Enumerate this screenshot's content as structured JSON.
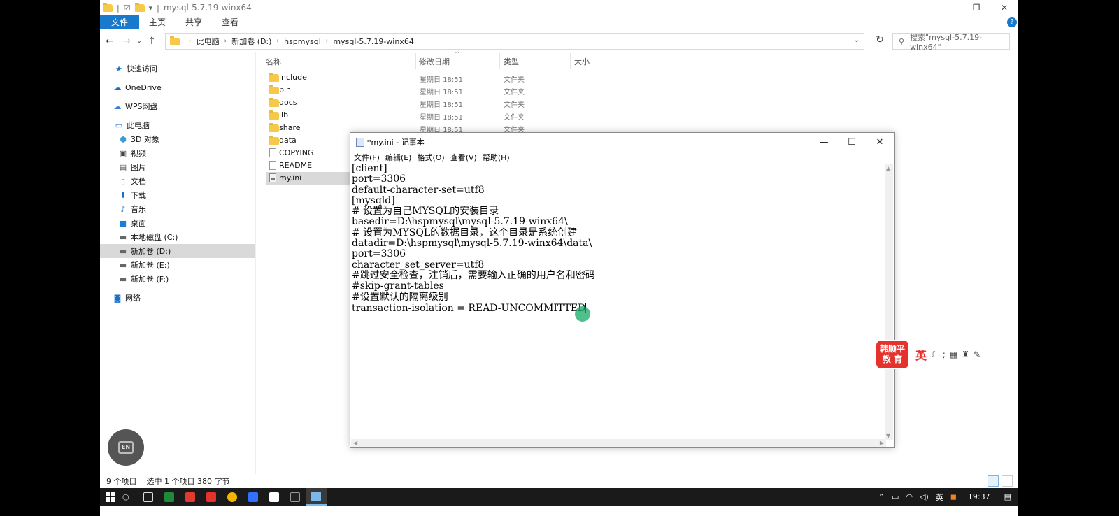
{
  "explorer": {
    "title": "mysql-5.7.19-winx64",
    "ribbon_tabs": [
      "文件",
      "主页",
      "共享",
      "查看"
    ],
    "breadcrumb": [
      "此电脑",
      "新加卷 (D:)",
      "hspmysql",
      "mysql-5.7.19-winx64"
    ],
    "search_placeholder": "搜索\"mysql-5.7.19-winx64\"",
    "nav": {
      "quick_access": "快速访问",
      "onedrive": "OneDrive",
      "wps": "WPS网盘",
      "this_pc": "此电脑",
      "objects3d": "3D 对象",
      "videos": "视频",
      "pictures": "图片",
      "documents": "文档",
      "downloads": "下载",
      "music": "音乐",
      "desktop": "桌面",
      "drive_c": "本地磁盘 (C:)",
      "drive_d": "新加卷 (D:)",
      "drive_e": "新加卷 (E:)",
      "drive_f": "新加卷 (F:)",
      "network": "网络"
    },
    "columns": {
      "name": "名称",
      "date": "修改日期",
      "type": "类型",
      "size": "大小"
    },
    "files": [
      {
        "name": "include",
        "date": "星期日 18:51",
        "type": "文件夹"
      },
      {
        "name": "bin",
        "date": "星期日 18:51",
        "type": "文件夹"
      },
      {
        "name": "docs",
        "date": "星期日 18:51",
        "type": "文件夹"
      },
      {
        "name": "lib",
        "date": "星期日 18:51",
        "type": "文件夹"
      },
      {
        "name": "share",
        "date": "星期日 18:51",
        "type": "文件夹"
      },
      {
        "name": "data",
        "date": "",
        "type": ""
      },
      {
        "name": "COPYING",
        "date": "",
        "type": ""
      },
      {
        "name": "README",
        "date": "",
        "type": ""
      },
      {
        "name": "my.ini",
        "date": "",
        "type": ""
      }
    ],
    "status": {
      "count": "9 个项目",
      "selection": "选中 1 个项目 380 字节"
    }
  },
  "notepad": {
    "title": "*my.ini - 记事本",
    "menu": [
      "文件(F)",
      "编辑(E)",
      "格式(O)",
      "查看(V)",
      "帮助(H)"
    ],
    "lines": [
      "[client]",
      "port=3306",
      "default-character-set=utf8",
      "[mysqld]",
      "# 设置为自己MYSQL的安装目录",
      "basedir=D:\\hspmysql\\mysql-5.7.19-winx64\\",
      "# 设置为MYSQL的数据目录，这个目录是系统创建",
      "datadir=D:\\hspmysql\\mysql-5.7.19-winx64\\data\\",
      "port=3306",
      "character_set_server=utf8",
      "#跳过安全检查，注销后，需要输入正确的用户名和密码",
      "#skip-grant-tables",
      "#设置默认的隔离级别",
      "transaction-isolation = READ-UNCOMMITTED"
    ]
  },
  "ime": {
    "logo_line1": "韩顺平",
    "logo_line2": "教 育",
    "lang": "英"
  },
  "en_button": "EN",
  "taskbar": {
    "tray_lang": "英",
    "time": "19:37"
  }
}
